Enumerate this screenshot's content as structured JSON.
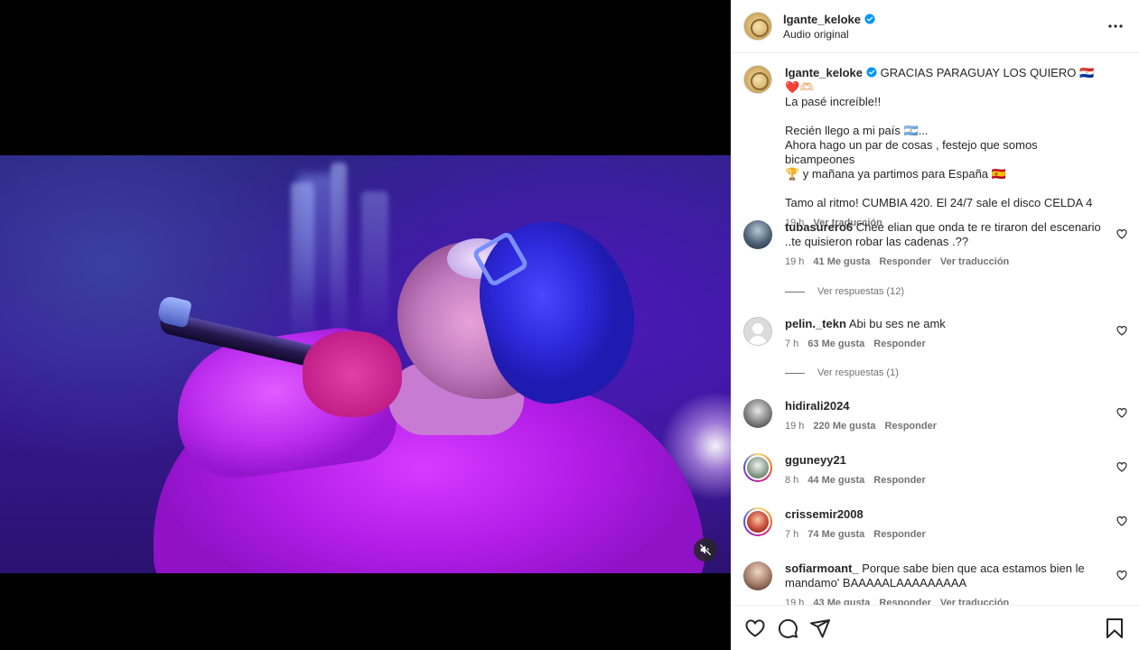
{
  "post": {
    "username": "lgante_keloke",
    "audio": "Audio original",
    "caption_lines": [
      "GRACIAS PARAGUAY LOS QUIERO 🇵🇾 ❤️🫶🏻",
      "La pasé increíble!!",
      "",
      "Recién llego a mi país 🇦🇷...",
      "Ahora hago un par de cosas , festejo que somos bicampeones",
      "🏆 y mañana ya partimos para España 🇪🇸",
      "",
      "Tamo al ritmo! CUMBIA 420. El 24/7 sale el disco CELDA 4"
    ],
    "time": "19 h",
    "see_translation": "Ver traducción"
  },
  "comments": [
    {
      "username": "tubasurero6",
      "text_line1": "Chee elian que onda te re tiraron del escenario",
      "text_line2": "..te quisieron robar las cadenas .??",
      "time": "19 h",
      "likes": "41 Me gusta",
      "reply": "Responder",
      "translate": "Ver traducción",
      "replies": "Ver respuestas (12)"
    },
    {
      "username": "pelin._tekn",
      "text_line1": "Abi bu ses ne amk",
      "time": "7 h",
      "likes": "63 Me gusta",
      "reply": "Responder",
      "replies": "Ver respuestas (1)"
    },
    {
      "username": "hidirali2024",
      "time": "19 h",
      "likes": "220 Me gusta",
      "reply": "Responder"
    },
    {
      "username": "gguneyy21",
      "time": "8 h",
      "likes": "44 Me gusta",
      "reply": "Responder"
    },
    {
      "username": "crissemir2008",
      "time": "7 h",
      "likes": "74 Me gusta",
      "reply": "Responder"
    },
    {
      "username": "sofiarmoant_",
      "text_line1": "Porque sabe bien que aca estamos bien le",
      "text_line2": "mandamo' BAAAAALAAAAAAAAA",
      "time": "19 h",
      "likes": "43 Me gusta",
      "reply": "Responder",
      "translate": "Ver traducción"
    }
  ],
  "icons": {
    "verified_color": "#0095f6",
    "like": "heart-icon",
    "comment": "comment-icon",
    "share": "share-icon",
    "save": "bookmark-icon",
    "more": "more-options-icon",
    "mute": "muted-speaker-icon"
  }
}
